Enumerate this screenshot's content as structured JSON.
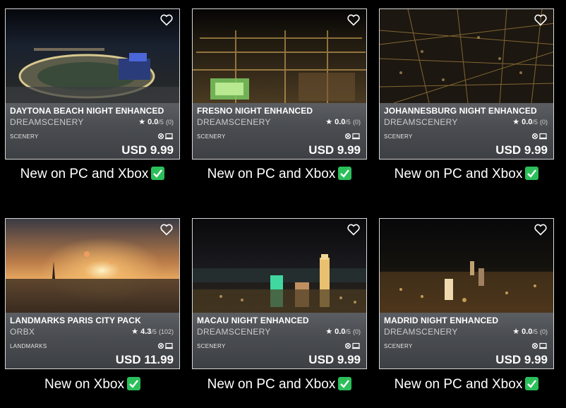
{
  "cards": [
    {
      "title": "DAYTONA BEACH NIGHT ENHANCED",
      "publisher": "DREAMSCENERY",
      "score": "0.0",
      "out_of": "/5",
      "count": "(0)",
      "category": "SCENERY",
      "price": "USD 9.99",
      "caption": "New on PC and Xbox"
    },
    {
      "title": "FRESNO NIGHT ENHANCED",
      "publisher": "DREAMSCENERY",
      "score": "0.0",
      "out_of": "/5",
      "count": "(0)",
      "category": "SCENERY",
      "price": "USD 9.99",
      "caption": "New on PC and Xbox"
    },
    {
      "title": "JOHANNESBURG NIGHT ENHANCED",
      "publisher": "DREAMSCENERY",
      "score": "0.0",
      "out_of": "/5",
      "count": "(0)",
      "category": "SCENERY",
      "price": "USD 9.99",
      "caption": "New on PC and Xbox"
    },
    {
      "title": "LANDMARKS PARIS CITY PACK",
      "publisher": "ORBX",
      "score": "4.3",
      "out_of": "/5",
      "count": "(102)",
      "category": "LANDMARKS",
      "price": "USD 11.99",
      "caption": "New on Xbox"
    },
    {
      "title": "MACAU NIGHT ENHANCED",
      "publisher": "DREAMSCENERY",
      "score": "0.0",
      "out_of": "/5",
      "count": "(0)",
      "category": "SCENERY",
      "price": "USD 9.99",
      "caption": "New on PC and Xbox"
    },
    {
      "title": "MADRID NIGHT ENHANCED",
      "publisher": "DREAMSCENERY",
      "score": "0.0",
      "out_of": "/5",
      "count": "(0)",
      "category": "SCENERY",
      "price": "USD 9.99",
      "caption": "New on PC and Xbox"
    }
  ],
  "colors": {
    "check_green": "#2bbf5a",
    "card_border": "#d8d8d8"
  },
  "icons": [
    "heart-icon",
    "star-icon",
    "xbox-icon",
    "pc-icon",
    "checkmark-icon"
  ]
}
